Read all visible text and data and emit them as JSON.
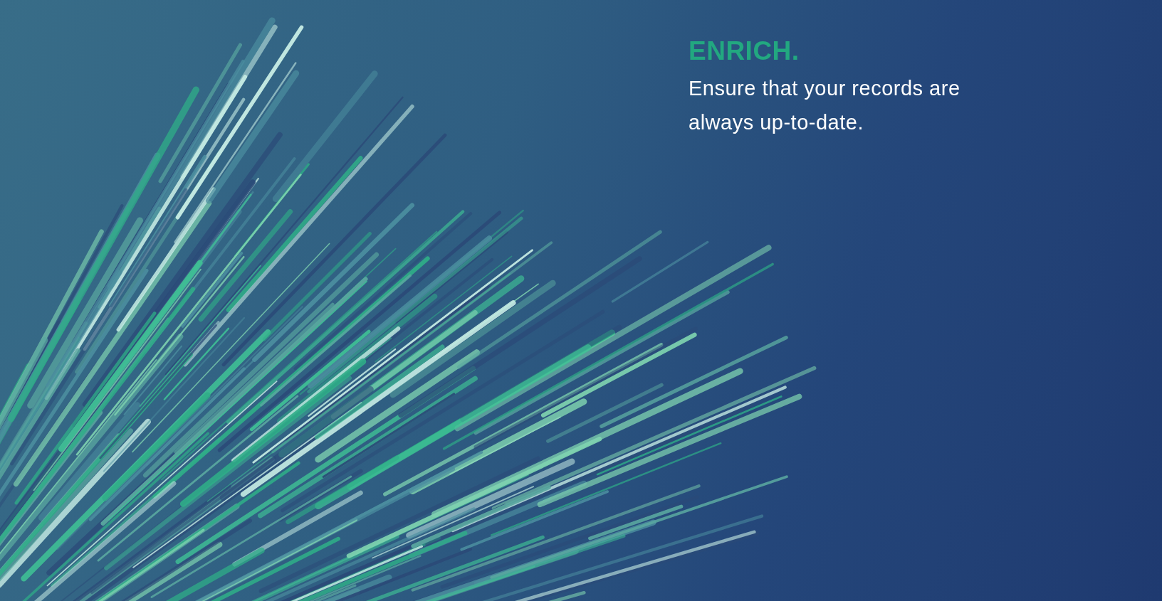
{
  "heading": "ENRICH.",
  "body": "Ensure that your records are always up-to-date."
}
